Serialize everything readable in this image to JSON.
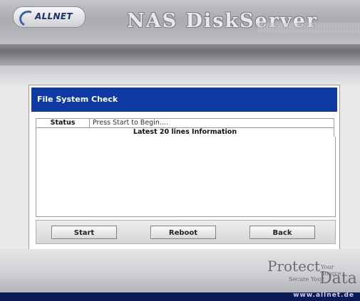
{
  "header": {
    "logo_text": "ALLNET",
    "app_title": "NAS DiskServer"
  },
  "panel": {
    "title": "File System Check",
    "status_label": "Status",
    "status_value": "Press Start to Begin....",
    "info_header": "Latest 20 lines Information",
    "log_lines": []
  },
  "buttons": {
    "start": "Start",
    "reboot": "Reboot",
    "back": "Back"
  },
  "footer": {
    "tagline_protect": "Protect",
    "tagline_your_source": "Your Source",
    "tagline_secure_your": "Secure Your",
    "tagline_data": "Data",
    "url": "www.allnet.de"
  },
  "colors": {
    "panel_header": "#0f3aa3",
    "footer_bar": "#0b1a55"
  }
}
